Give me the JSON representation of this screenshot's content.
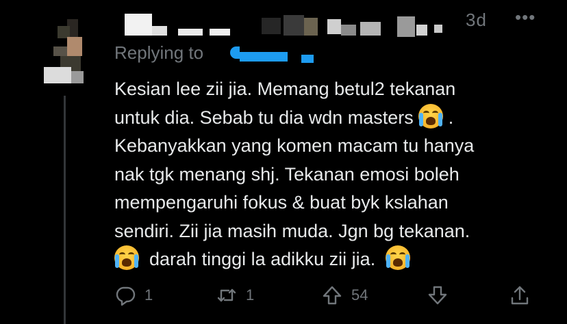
{
  "tweet": {
    "time": "3d",
    "more_label": "•••",
    "replying_prefix": "Replying to",
    "text_lines": [
      "Kesian lee zii jia. Memang betul2 tekanan",
      "untuk dia. Sebab tu dia wdn masters",
      "Kebanyakkan yang komen macam tu hanya",
      "nak tgk menang shj. Tekanan emosi boleh",
      "mempengaruhi fokus & buat byk kslahan",
      "sendiri. Zii jia masih muda. Jgn bg tekanan.",
      "darah tinggi la adikku zii jia."
    ],
    "line2_suffix": ".",
    "emoji_name": "loudly-crying-face",
    "actions": {
      "reply_count": "1",
      "retweet_count": "1",
      "upvote_count": "54"
    }
  },
  "colors": {
    "background": "#000000",
    "text": "#e7e9ea",
    "secondary": "#71767b",
    "mention_blur": "#1d9bf0"
  },
  "icons": [
    "reply-icon",
    "retweet-icon",
    "upvote-icon",
    "downvote-icon",
    "share-icon",
    "more-icon"
  ]
}
